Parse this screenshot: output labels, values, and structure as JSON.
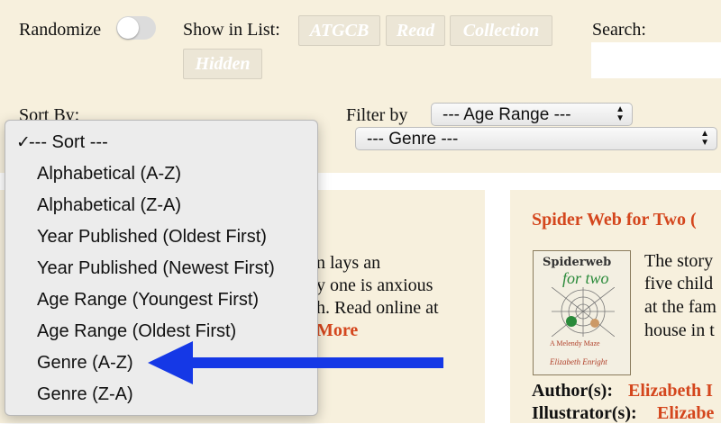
{
  "controls": {
    "randomize_label": "Randomize",
    "randomize_on": false,
    "show_in_list_label": "Show in List:",
    "show_chips": [
      "ATGCB",
      "Read",
      "Collection",
      "Hidden"
    ],
    "search_label": "Search:",
    "search_value": "",
    "sort_label": "Sort By:",
    "filter_label": "Filter by",
    "age_range_select": "--- Age Range ---",
    "genre_select": "--- Genre ---"
  },
  "sort_menu": {
    "selected_index": 0,
    "items": [
      "--- Sort ---",
      "Alphabetical (A-Z)",
      "Alphabetical (Z-A)",
      "Year Published (Oldest First)",
      "Year Published (Newest First)",
      "Age Range (Youngest First)",
      "Age Range (Oldest First)",
      "Genre (A-Z)",
      "Genre (Z-A)"
    ],
    "checkmark": "✓"
  },
  "left_card": {
    "lines": [
      "n lays an",
      "y one is anxious",
      "h. Read online at"
    ],
    "more_label": "More"
  },
  "right_card": {
    "title": "Spider Web for Two (",
    "cover_text": {
      "line1": "Spiderweb",
      "line2": "for two",
      "line3": "A Melendy Maze",
      "line4": "Elizabeth Enright"
    },
    "description_lines": [
      "The story",
      "five child",
      "at the fam",
      "house in t"
    ],
    "author_label": "Author(s):",
    "author_value": "Elizabeth I",
    "illustrator_label": "Illustrator(s):",
    "illustrator_value": "Elizabe"
  },
  "colors": {
    "page_background": "#f7f0dd",
    "link_accent": "#d4461d",
    "arrow": "#1538e6",
    "chip_bg": "#ece6d6"
  }
}
